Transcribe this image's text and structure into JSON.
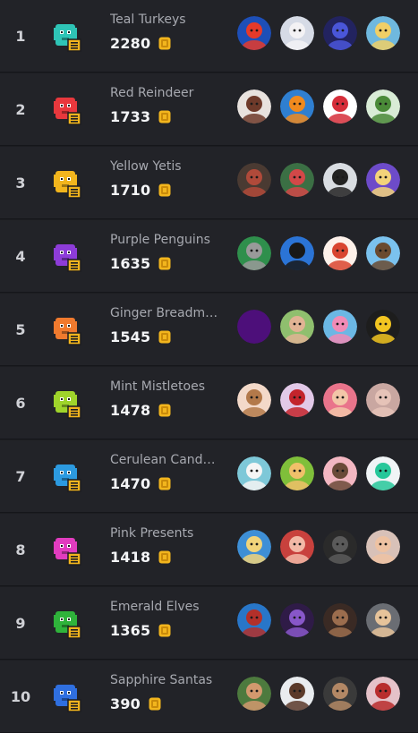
{
  "leaderboard": {
    "coin_color": "#f2b51d",
    "teams": [
      {
        "rank": "1",
        "name": "Teal Turkeys",
        "score": "2280",
        "icon": "teal-turkey-icon",
        "color": "#2ec4b6",
        "avatars": [
          {
            "name": "avatar-red-s-logo",
            "bg": "#1d4fb8",
            "fg": "#e53a2a"
          },
          {
            "name": "avatar-white-hair",
            "bg": "#d6dbe6",
            "fg": "#f3f2f4"
          },
          {
            "name": "avatar-blue-ghost",
            "bg": "#22235f",
            "fg": "#4a56d9"
          },
          {
            "name": "avatar-blonde-boy",
            "bg": "#6fb8de",
            "fg": "#f0cf66"
          }
        ]
      },
      {
        "rank": "2",
        "name": "Red Reindeer",
        "score": "1733",
        "icon": "red-reindeer-icon",
        "color": "#e8383d",
        "avatars": [
          {
            "name": "avatar-brown-hair-girl",
            "bg": "#e8e2de",
            "fg": "#6e3a2a"
          },
          {
            "name": "avatar-lightning-logo",
            "bg": "#2f7fd1",
            "fg": "#f08a1e"
          },
          {
            "name": "avatar-ranboo-live",
            "bg": "#ffffff",
            "fg": "#d62e3a"
          },
          {
            "name": "avatar-green-cap-kid",
            "bg": "#d9ecd6",
            "fg": "#4a8a38"
          }
        ]
      },
      {
        "rank": "3",
        "name": "Yellow Yetis",
        "score": "1710",
        "icon": "yellow-yeti-icon",
        "color": "#f2b51d",
        "avatars": [
          {
            "name": "avatar-dark-skin",
            "bg": "#4a3a32",
            "fg": "#b04a3a"
          },
          {
            "name": "avatar-green-zombie",
            "bg": "#3b6f44",
            "fg": "#d24848"
          },
          {
            "name": "avatar-sunglasses-bald",
            "bg": "#d9dde2",
            "fg": "#222222"
          },
          {
            "name": "avatar-blonde-girl-purple",
            "bg": "#6d4bc9",
            "fg": "#f3d37a"
          }
        ]
      },
      {
        "rank": "4",
        "name": "Purple Penguins",
        "score": "1635",
        "icon": "purple-penguin-icon",
        "color": "#8d3cd8",
        "avatars": [
          {
            "name": "avatar-cat",
            "bg": "#2f8f4c",
            "fg": "#9a9a9a"
          },
          {
            "name": "avatar-dark-hood",
            "bg": "#2b74d6",
            "fg": "#181818"
          },
          {
            "name": "avatar-red-hair",
            "bg": "#fdf1ea",
            "fg": "#d9452f"
          },
          {
            "name": "avatar-brown-hair-boy",
            "bg": "#7bc2ee",
            "fg": "#6a4a30"
          }
        ]
      },
      {
        "rank": "5",
        "name": "Ginger Breadmen",
        "score": "1545",
        "icon": "gingerbread-icon",
        "color": "#f07a2e",
        "avatars": [
          {
            "name": "avatar-purple-blank",
            "bg": "#4d0f7a",
            "fg": "#4d0f7a"
          },
          {
            "name": "avatar-smiling-man",
            "bg": "#8fbf6e",
            "fg": "#e1b394"
          },
          {
            "name": "avatar-pink-hair-girl",
            "bg": "#6bb7e4",
            "fg": "#f08bb6"
          },
          {
            "name": "avatar-yellow-creature",
            "bg": "#1d1d1d",
            "fg": "#f2c521"
          }
        ]
      },
      {
        "rank": "6",
        "name": "Mint Mistletoes",
        "score": "1478",
        "icon": "mistletoe-icon",
        "color": "#9fd42b",
        "avatars": [
          {
            "name": "avatar-woman-blonde",
            "bg": "#f3d9c9",
            "fg": "#b3794a"
          },
          {
            "name": "avatar-red-cap-girl",
            "bg": "#e2c9e8",
            "fg": "#c3242c"
          },
          {
            "name": "avatar-pink-headphones",
            "bg": "#e9748b",
            "fg": "#f3c6a8"
          },
          {
            "name": "avatar-blurry-face",
            "bg": "#c9a7a1",
            "fg": "#e6c3b8"
          }
        ]
      },
      {
        "rank": "7",
        "name": "Cerulean Candycanes",
        "score": "1470",
        "icon": "candycane-icon",
        "color": "#2c9ae0",
        "avatars": [
          {
            "name": "avatar-white-robot",
            "bg": "#7ec8d8",
            "fg": "#f5f5f5"
          },
          {
            "name": "avatar-green-hat-hero",
            "bg": "#7fbf3a",
            "fg": "#f0c06a"
          },
          {
            "name": "avatar-anime-brown",
            "bg": "#f3b7c2",
            "fg": "#6a4a38"
          },
          {
            "name": "avatar-green-headphones",
            "bg": "#f0f4f6",
            "fg": "#27c79a"
          }
        ]
      },
      {
        "rank": "8",
        "name": "Pink Presents",
        "score": "1418",
        "icon": "pink-present-icon",
        "color": "#e13cbf",
        "avatars": [
          {
            "name": "avatar-blonde-green-eyes",
            "bg": "#3e8fd6",
            "fg": "#f1d47a"
          },
          {
            "name": "avatar-red-curly-hair",
            "bg": "#c8413d",
            "fg": "#f2b8a6"
          },
          {
            "name": "avatar-dark-grey-logo",
            "bg": "#2a2a2a",
            "fg": "#5a5a5a"
          },
          {
            "name": "avatar-laughing-man",
            "bg": "#d8c1b8",
            "fg": "#eec2a2"
          }
        ]
      },
      {
        "rank": "9",
        "name": "Emerald Elves",
        "score": "1365",
        "icon": "emerald-elf-icon",
        "color": "#2fb33b",
        "avatars": [
          {
            "name": "avatar-red-hair-blue",
            "bg": "#2876c8",
            "fg": "#b3302a"
          },
          {
            "name": "avatar-purple-creature",
            "bg": "#2f1b47",
            "fg": "#8857c9"
          },
          {
            "name": "avatar-dark-man",
            "bg": "#3a2a24",
            "fg": "#9b6d4e"
          },
          {
            "name": "avatar-blond-boy-grey",
            "bg": "#6a6d73",
            "fg": "#e6c39a"
          }
        ]
      },
      {
        "rank": "10",
        "name": "Sapphire Santas",
        "score": "390",
        "icon": "sapphire-santa-icon",
        "color": "#2f6fe0",
        "avatars": [
          {
            "name": "avatar-bearded-man",
            "bg": "#4d7a3e",
            "fg": "#d2996e"
          },
          {
            "name": "avatar-man-in-car",
            "bg": "#e9ecef",
            "fg": "#5b3a2a"
          },
          {
            "name": "avatar-bearded-close-up",
            "bg": "#3a3a3a",
            "fg": "#b38865"
          },
          {
            "name": "avatar-red-hair-woman",
            "bg": "#e5c2c9",
            "fg": "#b82d2d"
          }
        ]
      }
    ]
  }
}
